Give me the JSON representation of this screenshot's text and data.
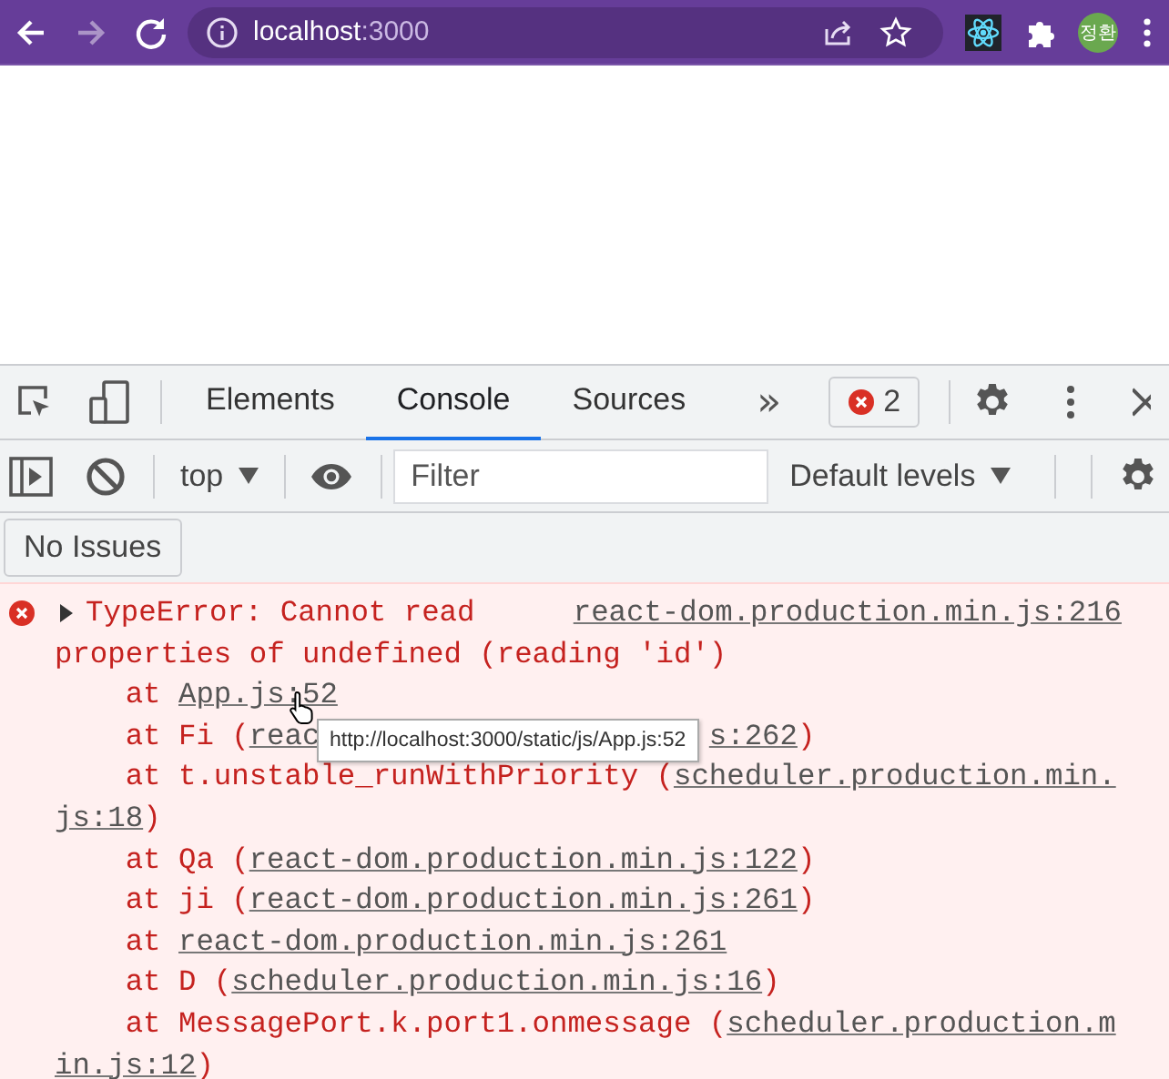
{
  "browser": {
    "nav": [
      {
        "kind": "back",
        "disabled": false
      },
      {
        "kind": "forward",
        "disabled": true
      },
      {
        "kind": "reload",
        "disabled": false
      }
    ],
    "url": {
      "host": "localhost",
      "port": ":3000"
    },
    "profile": {
      "initials": "정환"
    }
  },
  "devtools": {
    "tabs": [
      {
        "label": "Elements",
        "selected": false
      },
      {
        "label": "Console",
        "selected": true
      },
      {
        "label": "Sources",
        "selected": false
      }
    ],
    "more_tabs": "»",
    "error_count": "2",
    "console_toolbar": {
      "context": "top",
      "filter": {
        "placeholder": "Filter"
      },
      "levels": "Default levels"
    },
    "issues_button": "No Issues",
    "message": {
      "expanded": false,
      "source": "react-dom.production.min.js:216",
      "lines": [
        {
          "kind": "head",
          "segments": [
            {
              "text": "TypeError: Cannot read",
              "link": false
            }
          ]
        },
        {
          "kind": "wrap",
          "segments": [
            {
              "text": "properties of undefined (reading 'id')",
              "link": false
            }
          ]
        },
        {
          "kind": "frame",
          "segments": [
            {
              "text": "at ",
              "link": false
            },
            {
              "text": "App.js:52",
              "link": true
            }
          ]
        },
        {
          "kind": "frame",
          "segments": [
            {
              "text": "at Fi (",
              "link": false
            },
            {
              "text": "reac",
              "link": true,
              "covered_after": true
            },
            {
              "text": "s:262",
              "link": true
            },
            {
              "text": ")",
              "link": false
            }
          ]
        },
        {
          "kind": "frame",
          "segments": [
            {
              "text": "at t.unstable_runWithPriority (",
              "link": false
            },
            {
              "text": "scheduler.production.min.",
              "link": true
            }
          ]
        },
        {
          "kind": "wrap",
          "segments": [
            {
              "text": "js:18",
              "link": true
            },
            {
              "text": ")",
              "link": false
            }
          ]
        },
        {
          "kind": "frame",
          "segments": [
            {
              "text": "at Qa (",
              "link": false
            },
            {
              "text": "react-dom.production.min.js:122",
              "link": true
            },
            {
              "text": ")",
              "link": false
            }
          ]
        },
        {
          "kind": "frame",
          "segments": [
            {
              "text": "at ji (",
              "link": false
            },
            {
              "text": "react-dom.production.min.js:261",
              "link": true
            },
            {
              "text": ")",
              "link": false
            }
          ]
        },
        {
          "kind": "frame",
          "segments": [
            {
              "text": "at ",
              "link": false
            },
            {
              "text": "react-dom.production.min.js:261",
              "link": true
            }
          ]
        },
        {
          "kind": "frame",
          "segments": [
            {
              "text": "at D (",
              "link": false
            },
            {
              "text": "scheduler.production.min.js:16",
              "link": true
            },
            {
              "text": ")",
              "link": false
            }
          ]
        },
        {
          "kind": "frame",
          "segments": [
            {
              "text": "at MessagePort.k.port1.onmessage (",
              "link": false
            },
            {
              "text": "scheduler.production.m",
              "link": true
            }
          ]
        },
        {
          "kind": "wrap",
          "segments": [
            {
              "text": "in.js:12",
              "link": true
            },
            {
              "text": ")",
              "link": false
            }
          ]
        }
      ]
    },
    "tooltip": "http://localhost:3000/static/js/App.js:52"
  }
}
